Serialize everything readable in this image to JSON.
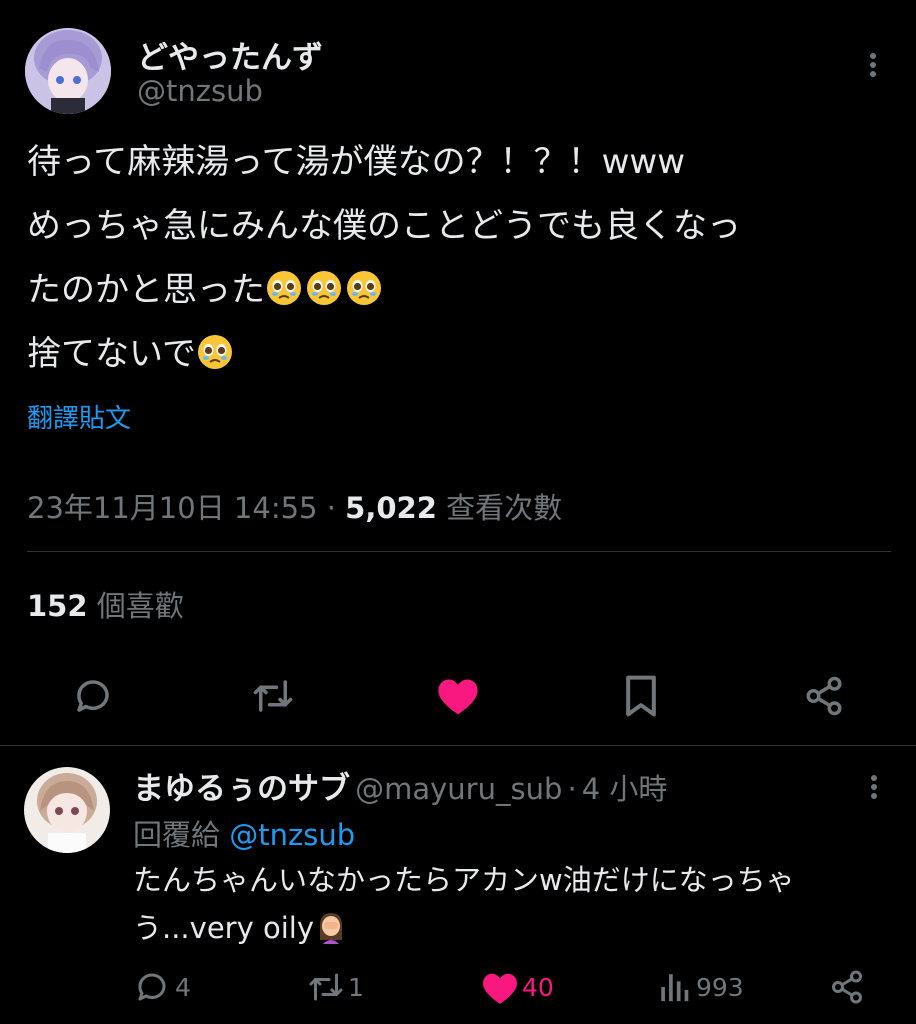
{
  "tweet": {
    "author_name": "どやったんず",
    "author_handle": "@tnzsub",
    "lines": [
      "待って麻辣湯って湯が僕なの？！？！www",
      "めっちゃ急にみんな僕のことどうでも良くなっ",
      "たのかと思った",
      "捨てないで"
    ],
    "translate_label": "翻譯貼文",
    "timestamp": "23年11月10日 14:55",
    "separator": "·",
    "views_count": "5,022",
    "views_label": "查看次數",
    "likes_count": "152",
    "likes_label": "個喜歡"
  },
  "reply": {
    "author_name": "まゆるぅのサブ",
    "author_handle": "@mayuru_sub",
    "separator": "·",
    "time": "4 小時",
    "replying_label": "回覆給",
    "replying_to": "@tnzsub",
    "lines": [
      "たんちゃんいなかったらアカンw油だけになっちゃ",
      "う...very oily"
    ],
    "reply_count": "4",
    "retweet_count": "1",
    "like_count": "40",
    "view_count": "993"
  },
  "icons": {
    "reply": "speech-bubble-icon",
    "retweet": "retweet-arrows-icon",
    "like": "heart-icon",
    "bookmark": "bookmark-icon",
    "share": "share-icon",
    "views": "bar-chart-icon",
    "more": "three-dots-vertical-icon"
  },
  "colors": {
    "background": "#000000",
    "text": "#e7e9ea",
    "muted": "#71767b",
    "link": "#1d9bf0",
    "like": "#f91880",
    "divider": "#2f3336"
  }
}
